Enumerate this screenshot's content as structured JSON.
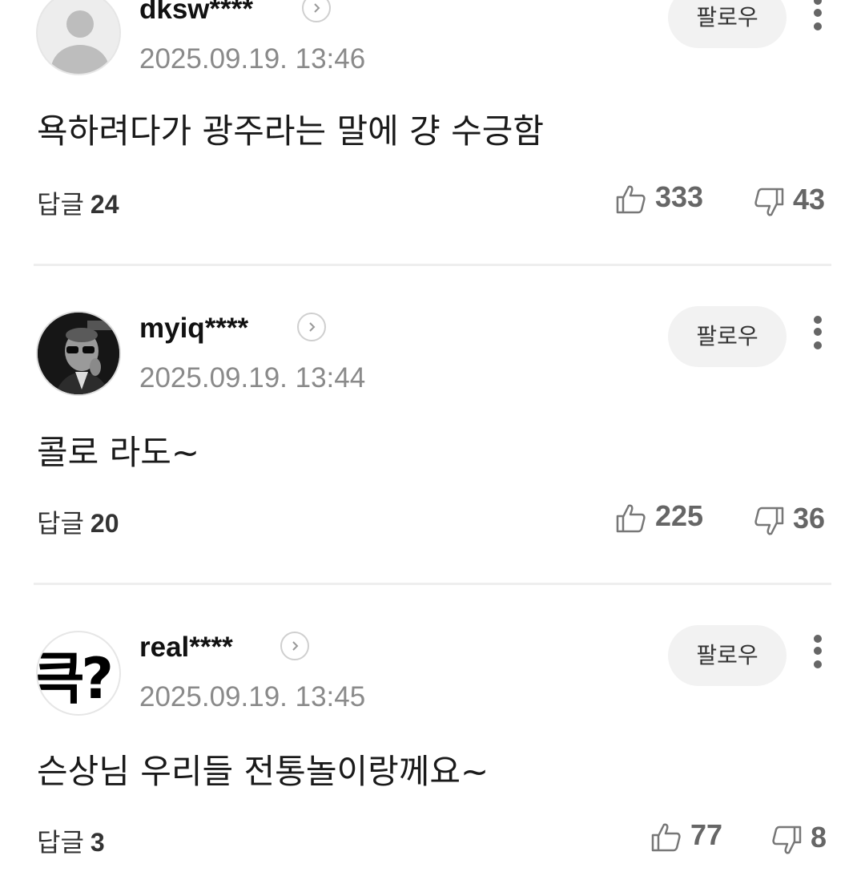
{
  "comments": [
    {
      "username": "dksw****",
      "date": "2025.09.19. 13:46",
      "follow_label": "팔로우",
      "text": "욕하려다가 광주라는 말에 걍 수긍함",
      "reply_label": "답글",
      "reply_count": "24",
      "likes": "333",
      "dislikes": "43",
      "avatar": "default-person-avatar"
    },
    {
      "username": "myiq****",
      "date": "2025.09.19. 13:44",
      "follow_label": "팔로우",
      "text": "콜로 라도~",
      "reply_label": "답글",
      "reply_count": "20",
      "likes": "225",
      "dislikes": "36",
      "avatar": "photo-man-sunglasses-avatar"
    },
    {
      "username": "real****",
      "date": "2025.09.19. 13:45",
      "follow_label": "팔로우",
      "text": "슨상님 우리들 전통놀이랑께요~",
      "reply_label": "답글",
      "reply_count": "3",
      "likes": "77",
      "dislikes": "8",
      "avatar": "glyph-avatar",
      "avatar_text": "큭?"
    }
  ]
}
